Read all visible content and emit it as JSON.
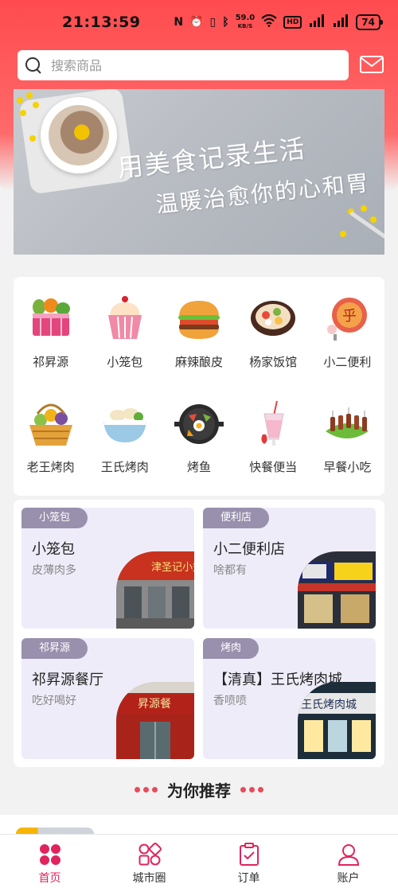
{
  "status_bar": {
    "time": "21:13:59",
    "speed_value": "59.0",
    "speed_unit": "KB/S",
    "hd_label": "HD",
    "battery": "74"
  },
  "search": {
    "placeholder": "搜索商品"
  },
  "banner": {
    "line1": "用美食记录生活",
    "line2": "温暖治愈你的心和胃"
  },
  "categories": [
    {
      "label": "祁昇源",
      "icon": "vegetable-basket-icon"
    },
    {
      "label": "小笼包",
      "icon": "cupcake-icon"
    },
    {
      "label": "麻辣酿皮",
      "icon": "burger-icon"
    },
    {
      "label": "杨家饭馆",
      "icon": "hotpot-icon"
    },
    {
      "label": "小二便利",
      "icon": "pizza-icon"
    },
    {
      "label": "老王烤肉",
      "icon": "fruit-basket-icon"
    },
    {
      "label": "王氏烤肉",
      "icon": "dumpling-bowl-icon"
    },
    {
      "label": "烤鱼",
      "icon": "bibimbap-pan-icon"
    },
    {
      "label": "快餐便当",
      "icon": "milkshake-icon"
    },
    {
      "label": "早餐小吃",
      "icon": "skewer-icon"
    }
  ],
  "shops": [
    {
      "tag": "小笼包",
      "name": "小笼包",
      "desc": "皮薄肉多",
      "sign_text": "津圣记小笼"
    },
    {
      "tag": "便利店",
      "name": "小二便利店",
      "desc": "啥都有",
      "sign_text": ""
    },
    {
      "tag": "祁昇源",
      "name": "祁昇源餐厅",
      "desc": "吃好喝好",
      "sign_text": "昇源餐"
    },
    {
      "tag": "烤肉",
      "name": "【清真】王氏烤肉城",
      "desc": "香喷喷",
      "sign_text": "王氏烤肉城"
    }
  ],
  "recommend": {
    "title": "为你推荐"
  },
  "tabs": [
    {
      "label": "首页",
      "icon": "home-grid-icon",
      "active": true
    },
    {
      "label": "城市圈",
      "icon": "city-circle-icon",
      "active": false
    },
    {
      "label": "订单",
      "icon": "order-clipboard-icon",
      "active": false
    },
    {
      "label": "账户",
      "icon": "account-person-icon",
      "active": false
    }
  ],
  "colors": {
    "brand_red": "#ff4b4f",
    "active_tab": "#e0245e",
    "shop_card_bg": "#efecf9",
    "shop_tag_bg": "#9990ad"
  }
}
